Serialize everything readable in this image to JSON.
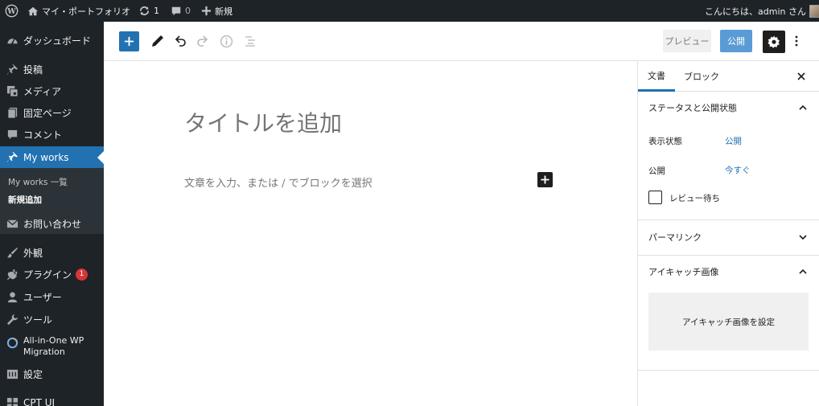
{
  "adminbar": {
    "site_name": "マイ・ポートフォリオ",
    "updates_count": "1",
    "comments_count": "0",
    "new_label": "新規",
    "greeting": "こんにちは、admin さん"
  },
  "sidebar": {
    "items": [
      {
        "label": "ダッシュボード",
        "icon": "dashboard-icon"
      },
      {
        "label": "投稿",
        "icon": "pin-icon"
      },
      {
        "label": "メディア",
        "icon": "media-icon"
      },
      {
        "label": "固定ページ",
        "icon": "page-icon"
      },
      {
        "label": "コメント",
        "icon": "comment-icon"
      },
      {
        "label": "My works",
        "icon": "pin-icon"
      },
      {
        "label": "お問い合わせ",
        "icon": "mail-icon"
      },
      {
        "label": "外観",
        "icon": "brush-icon"
      },
      {
        "label": "プラグイン",
        "icon": "plugin-icon",
        "badge": "1"
      },
      {
        "label": "ユーザー",
        "icon": "user-icon"
      },
      {
        "label": "ツール",
        "icon": "wrench-icon"
      },
      {
        "label": "All-in-One WP Migration",
        "icon": "migration-icon"
      },
      {
        "label": "設定",
        "icon": "settings-icon"
      },
      {
        "label": "CPT UI",
        "icon": "cpt-icon"
      }
    ],
    "submenu": [
      {
        "label": "My works 一覧"
      },
      {
        "label": "新規追加"
      }
    ]
  },
  "toolbar": {
    "preview_label": "プレビュー",
    "publish_label": "公開"
  },
  "editor": {
    "title_placeholder": "タイトルを追加",
    "block_placeholder": "文章を入力、または / でブロックを選択"
  },
  "panel": {
    "tabs": [
      "文書",
      "ブロック"
    ],
    "status_section": "ステータスと公開状態",
    "visibility_label": "表示状態",
    "visibility_value": "公開",
    "publish_label": "公開",
    "publish_value": "今すぐ",
    "pending_review_label": "レビュー待ち",
    "permalink_section": "パーマリンク",
    "featured_section": "アイキャッチ画像",
    "set_featured_label": "アイキャッチ画像を設定"
  },
  "colors": {
    "admin_dark": "#1d2327",
    "accent": "#2271b1",
    "publish": "#5b9bd5"
  }
}
